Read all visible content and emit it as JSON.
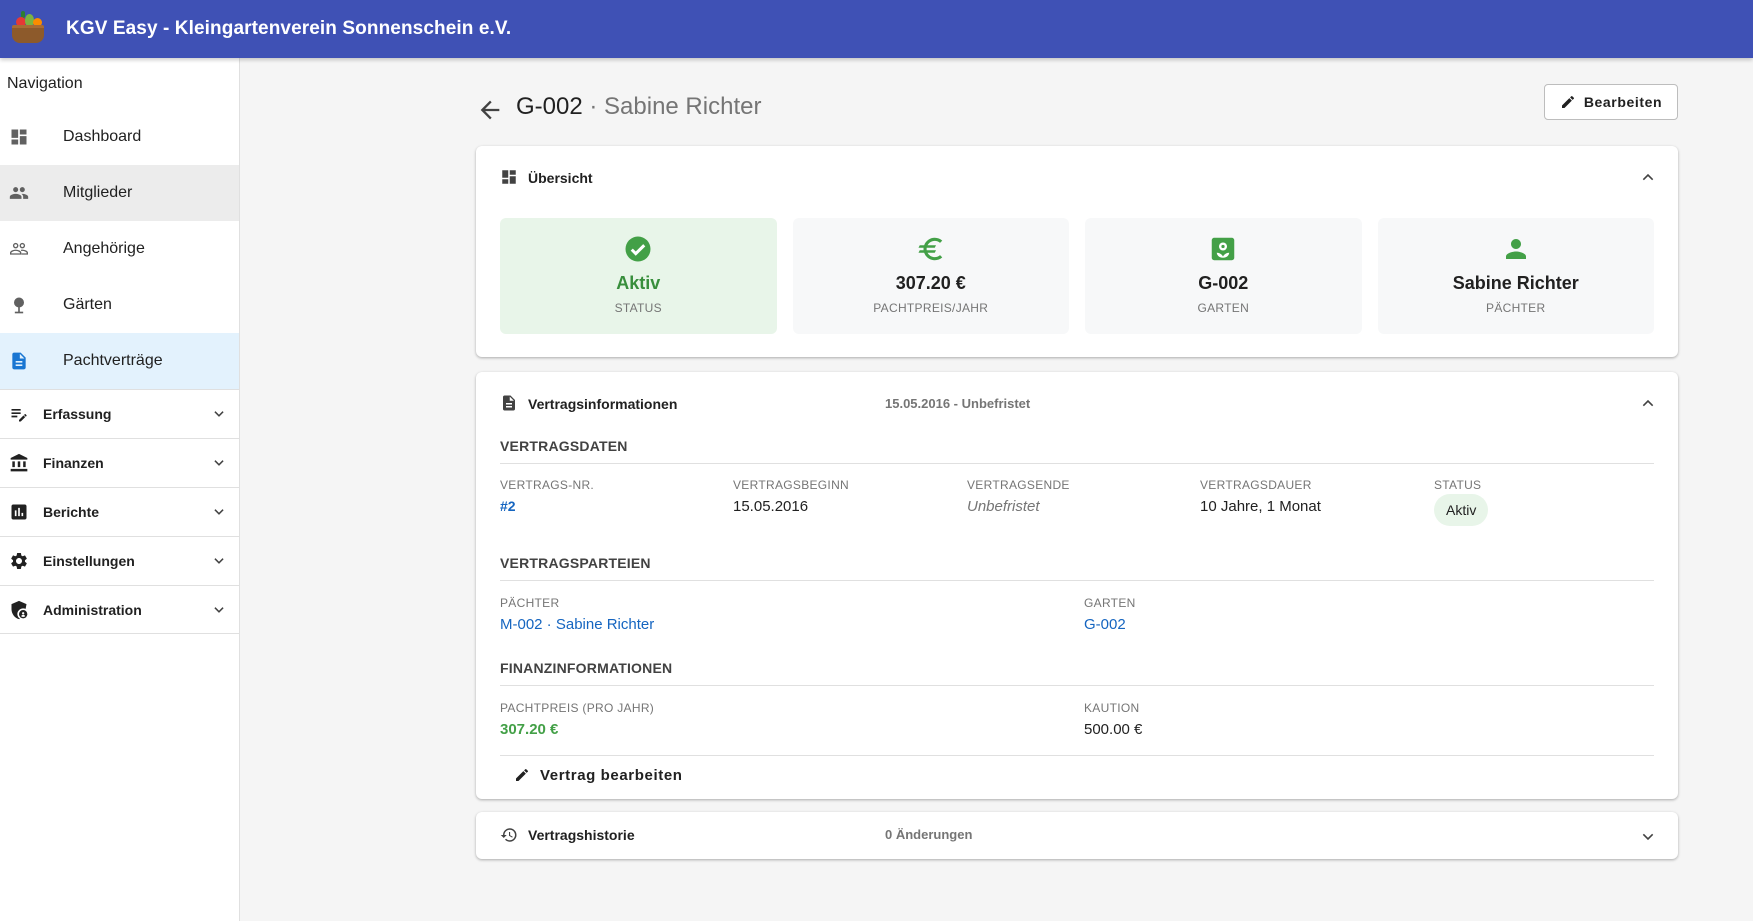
{
  "app": {
    "title": "KGV Easy - Kleingartenverein Sonnenschein e.V."
  },
  "sidebar": {
    "heading": "Navigation",
    "items": [
      {
        "label": "Dashboard",
        "icon": "dashboard-icon"
      },
      {
        "label": "Mitglieder",
        "icon": "members-icon"
      },
      {
        "label": "Angehörige",
        "icon": "relatives-icon"
      },
      {
        "label": "Gärten",
        "icon": "garden-icon"
      },
      {
        "label": "Pachtverträge",
        "icon": "contract-icon"
      }
    ],
    "groups": [
      {
        "label": "Erfassung",
        "icon": "edit-list-icon"
      },
      {
        "label": "Finanzen",
        "icon": "bank-icon"
      },
      {
        "label": "Berichte",
        "icon": "chart-icon"
      },
      {
        "label": "Einstellungen",
        "icon": "gear-icon"
      },
      {
        "label": "Administration",
        "icon": "admin-shield-icon"
      }
    ]
  },
  "page": {
    "id": "G-002",
    "separator": " · ",
    "name": "Sabine Richter",
    "edit_label": "Bearbeiten"
  },
  "overview": {
    "title": "Übersicht",
    "cards": [
      {
        "value": "Aktiv",
        "label": "STATUS",
        "icon": "check-circle-icon"
      },
      {
        "value": "307.20 €",
        "label": "PACHTPREIS/JAHR",
        "icon": "euro-icon"
      },
      {
        "value": "G-002",
        "label": "GARTEN",
        "icon": "garden-plot-icon"
      },
      {
        "value": "Sabine Richter",
        "label": "PÄCHTER",
        "icon": "person-icon"
      }
    ]
  },
  "contract": {
    "title": "Vertragsinformationen",
    "subtitle": "15.05.2016 - Unbefristet",
    "data_section": "VERTRAGSDATEN",
    "fields": [
      {
        "label": "VERTRAGS-NR.",
        "value": "#2"
      },
      {
        "label": "VERTRAGSBEGINN",
        "value": "15.05.2016"
      },
      {
        "label": "VERTRAGSENDE",
        "value": "Unbefristet"
      },
      {
        "label": "VERTRAGSDAUER",
        "value": "10 Jahre, 1 Monat"
      },
      {
        "label": "STATUS",
        "value": "Aktiv"
      }
    ],
    "parties_section": "VERTRAGSPARTEIEN",
    "tenant_label": "PÄCHTER",
    "tenant_value": "M-002 · Sabine Richter",
    "garden_label": "GARTEN",
    "garden_value": "G-002",
    "finance_section": "FINANZINFORMATIONEN",
    "rent_label": "PACHTPREIS (PRO JAHR)",
    "rent_value": "307.20 €",
    "deposit_label": "KAUTION",
    "deposit_value": "500.00 €",
    "edit_contract_label": "Vertrag bearbeiten"
  },
  "history": {
    "title": "Vertragshistorie",
    "subtitle": "0 Änderungen"
  },
  "colors": {
    "appbar": "#3f51b5",
    "active_nav": "#e3f2fd",
    "success": "#43a047",
    "link": "#1565c0"
  }
}
